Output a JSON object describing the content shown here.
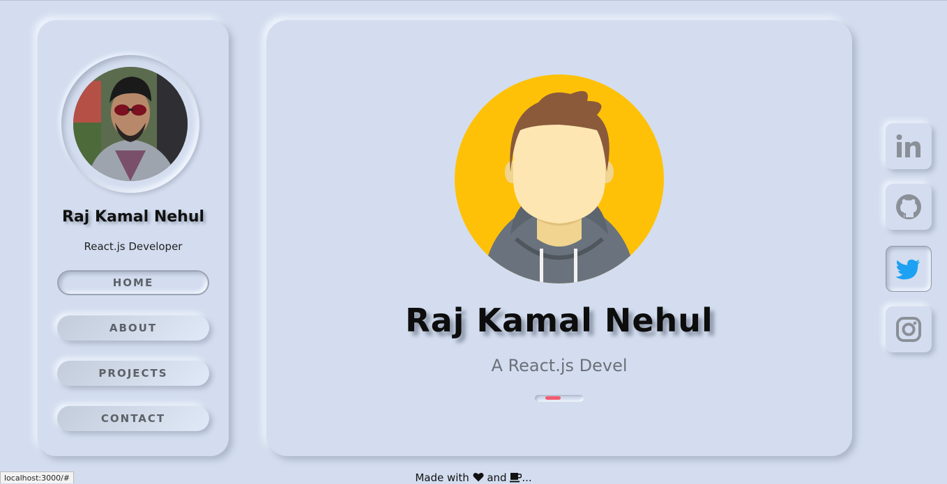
{
  "sidebar": {
    "name": "Raj Kamal Nehul",
    "role": "React.js Developer",
    "nav": [
      {
        "label": "HOME",
        "active": true
      },
      {
        "label": "ABOUT",
        "active": false
      },
      {
        "label": "PROJECTS",
        "active": false
      },
      {
        "label": "CONTACT",
        "active": false
      }
    ]
  },
  "hero": {
    "name": "Raj Kamal Nehul",
    "subtitle": "A React.js Devel",
    "progress": 0.55
  },
  "social": [
    {
      "icon": "linkedin-icon",
      "active": false
    },
    {
      "icon": "github-icon",
      "active": false
    },
    {
      "icon": "twitter-icon",
      "active": true
    },
    {
      "icon": "instagram-icon",
      "active": false
    }
  ],
  "footer": {
    "prefix": "Made with",
    "middle": "and",
    "suffix": "..."
  },
  "status_bar": "localhost:3000/#",
  "colors": {
    "background": "#d3ddef",
    "accent": "#f25c6e",
    "twitter": "#1da1f2",
    "avatar_bg": "#ffc107"
  }
}
